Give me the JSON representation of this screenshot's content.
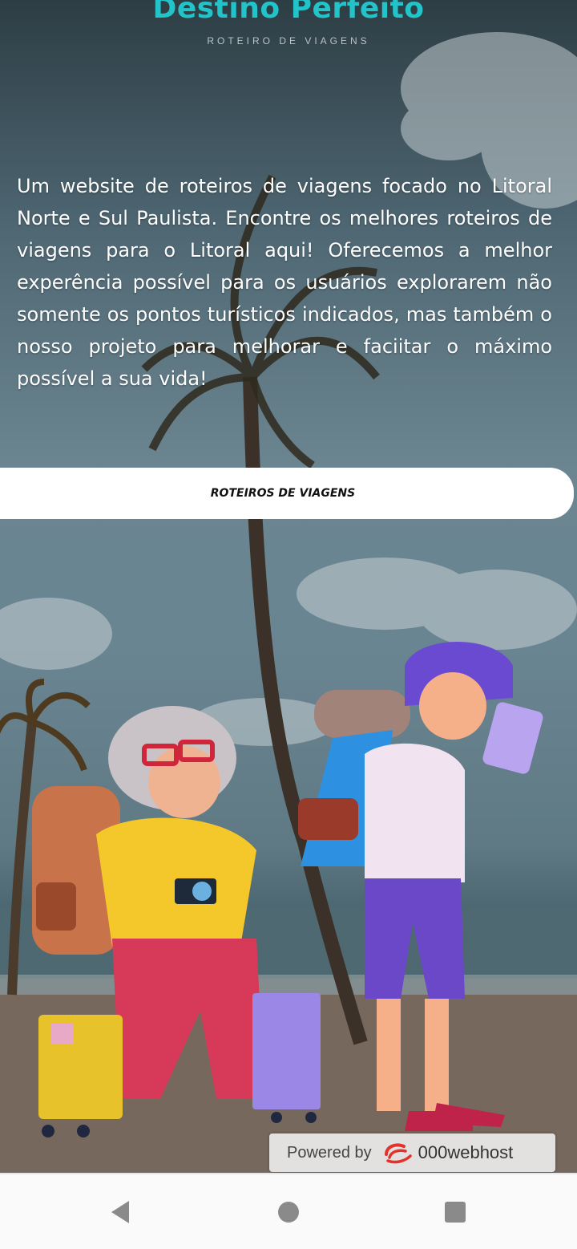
{
  "header": {
    "title": "Destino Perfeito",
    "subtitle": "ROTEIRO DE VIAGENS"
  },
  "intro": {
    "text": "Um website de roteiros de viagens focado no Litoral Norte e Sul Paulista. Encontre os melhores roteiros de viagens para o Litoral aqui! Oferecemos a melhor experência possível para os usuários explorarem não somente os pontos turísticos indicados, mas também o nosso projeto para melhorar e faciitar o máximo possível a sua vida!"
  },
  "cta": {
    "label": "ROTEIROS DE VIAGENS"
  },
  "badge": {
    "powered_label": "Powered by",
    "host_label": "000webhost",
    "icon": "000webhost-logo-icon"
  },
  "navigation": {
    "back_icon": "back-icon",
    "home_icon": "home-icon",
    "recents_icon": "recents-icon"
  },
  "colors": {
    "brand_title": "#23c4c9",
    "nav_icon": "#8a8a8a",
    "logo_red": "#e3322b"
  }
}
